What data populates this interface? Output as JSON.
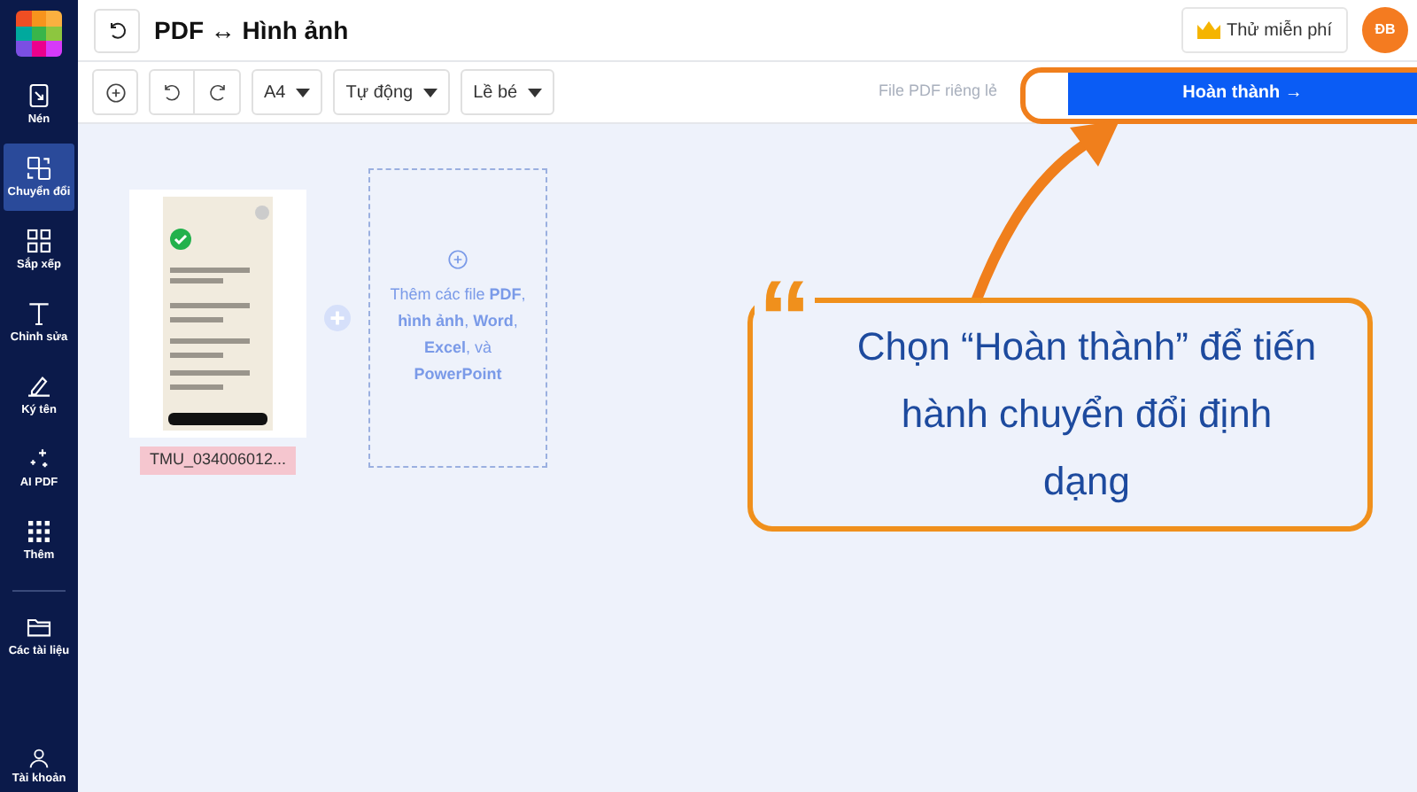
{
  "sidebar": {
    "items": [
      {
        "kind": "compress",
        "label": "Nén",
        "selected": false
      },
      {
        "kind": "convert",
        "label": "Chuyển đổi",
        "selected": true
      },
      {
        "kind": "arrange",
        "label": "Sắp xếp",
        "selected": false
      },
      {
        "kind": "edit",
        "label": "Chỉnh sửa",
        "selected": false
      },
      {
        "kind": "sign",
        "label": "Ký tên",
        "selected": false
      },
      {
        "kind": "ai",
        "label": "AI PDF",
        "selected": false
      },
      {
        "kind": "more",
        "label": "Thêm",
        "selected": false
      },
      {
        "kind": "docs",
        "label": "Các tài liệu",
        "selected": false
      }
    ],
    "account": "Tài khoản"
  },
  "header": {
    "title": "PDF ↔ Hình ảnh",
    "trial_button": "Thử miễn phí",
    "avatar": "ĐB"
  },
  "toolbar": {
    "dropdowns": [
      "A4",
      "Tự động",
      "Lề bé"
    ],
    "separate_files": "File PDF riêng lẻ",
    "finish_button": "Hoàn thành →"
  },
  "files": [
    {
      "name": "TMU_034006012..."
    }
  ],
  "add_files": "Thêm các file **PDF**, **hình ảnh**, **Word**, **Excel**, và **PowerPoint**",
  "callout": {
    "quote": "“",
    "text": "Chọn “Hoàn thành” để tiến hành chuyển đổi định dạng"
  }
}
